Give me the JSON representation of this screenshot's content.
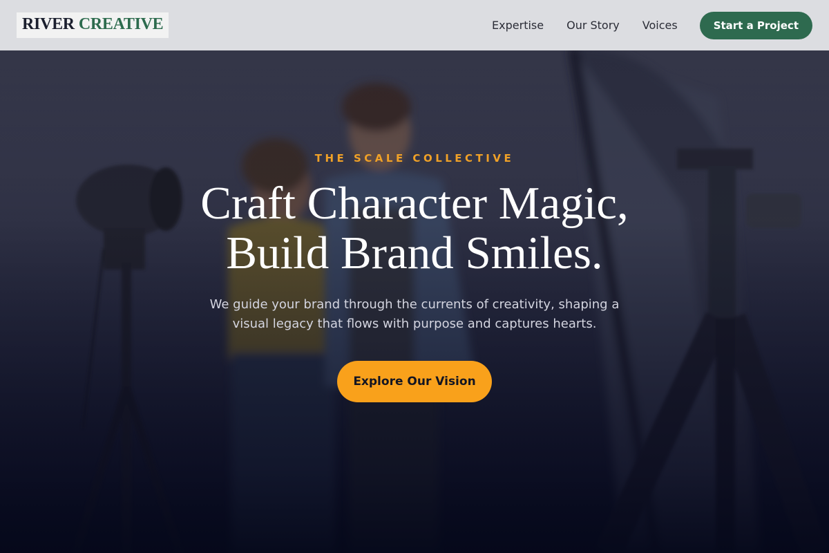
{
  "nav": {
    "logo": {
      "word1": "RIVER",
      "word2": "CREATIVE"
    },
    "links": [
      "Expertise",
      "Our Story",
      "Voices"
    ],
    "cta_label": "Start a Project"
  },
  "hero": {
    "eyebrow": "THE SCALE COLLECTIVE",
    "headline_line1": "Craft Character Magic,",
    "headline_line2": "Build Brand Smiles.",
    "subtext_line1": "We guide your brand through the currents of creativity, shaping a",
    "subtext_line2": "visual legacy that flows with purpose and captures hearts.",
    "cta_label": "Explore Our Vision"
  },
  "colors": {
    "brand_green": "#2e6a4f",
    "accent_orange": "#f9a11b",
    "eyebrow_orange": "#f0a127",
    "nav_bg": "#e2e3e6",
    "hero_dark": "#0b0f24"
  }
}
